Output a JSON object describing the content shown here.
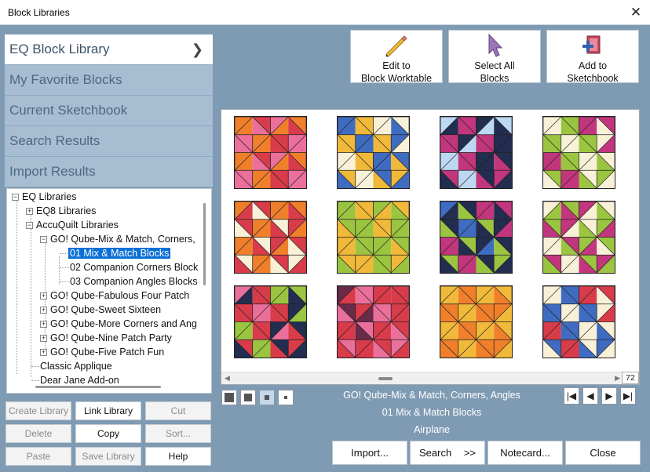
{
  "window": {
    "title": "Block Libraries"
  },
  "nav": {
    "items": [
      {
        "label": "EQ Block Library",
        "active": true
      },
      {
        "label": "My Favorite Blocks"
      },
      {
        "label": "Current Sketchbook"
      },
      {
        "label": "Search Results"
      },
      {
        "label": "Import Results"
      }
    ]
  },
  "tree": {
    "nodes": [
      {
        "label": "EQ Libraries",
        "exp": "−"
      },
      {
        "label": "EQ8 Libraries",
        "exp": "+"
      },
      {
        "label": "AccuQuilt Libraries",
        "exp": "−"
      },
      {
        "label": "GO! Qube-Mix & Match, Corners,",
        "exp": "−"
      },
      {
        "label": "01 Mix & Match Blocks",
        "selected": true
      },
      {
        "label": "02 Companion Corners Block"
      },
      {
        "label": "03 Companion Angles Blocks"
      },
      {
        "label": "GO! Qube-Fabulous Four Patch",
        "exp": "+"
      },
      {
        "label": "GO! Qube-Sweet Sixteen",
        "exp": "+"
      },
      {
        "label": "GO! Qube-More Corners and Ang",
        "exp": "+"
      },
      {
        "label": "GO! Qube-Nine Patch Party",
        "exp": "+"
      },
      {
        "label": "GO! Qube-Five Patch Fun",
        "exp": "+"
      },
      {
        "label": "Classic Applique"
      },
      {
        "label": "Dear Jane Add-on"
      }
    ]
  },
  "lib_buttons": {
    "create": "Create Library",
    "link": "Link Library",
    "cut": "Cut",
    "delete": "Delete",
    "copy": "Copy",
    "sort": "Sort...",
    "paste": "Paste",
    "save": "Save Library",
    "help": "Help"
  },
  "toolbar": {
    "edit_line1": "Edit to",
    "edit_line2": "Block Worktable",
    "select_line1": "Select All",
    "select_line2": "Blocks",
    "add_line1": "Add to",
    "add_line2": "Sketchbook"
  },
  "viewer": {
    "count": "72"
  },
  "info": {
    "library": "GO! Qube-Mix & Match, Corners, Angles",
    "sublibrary": "01 Mix & Match Blocks",
    "block_name": "Airplane"
  },
  "bottom": {
    "import": "Import...",
    "search": "Search",
    "search_arrow": ">>",
    "notecard": "Notecard...",
    "close": "Close"
  },
  "icons": {
    "close": "close-icon",
    "chevron": "chevron-right-icon",
    "edit": "pencil-icon",
    "select": "arrow-cursor-icon",
    "add": "add-to-sketchbook-icon",
    "first": "first-page-icon",
    "prev": "previous-icon",
    "next": "next-icon",
    "last": "last-page-icon"
  },
  "colors": {
    "window_bg": "#7f9bb3",
    "selected": "#0a6fd6",
    "nav_bg": "#a7bdd2"
  }
}
